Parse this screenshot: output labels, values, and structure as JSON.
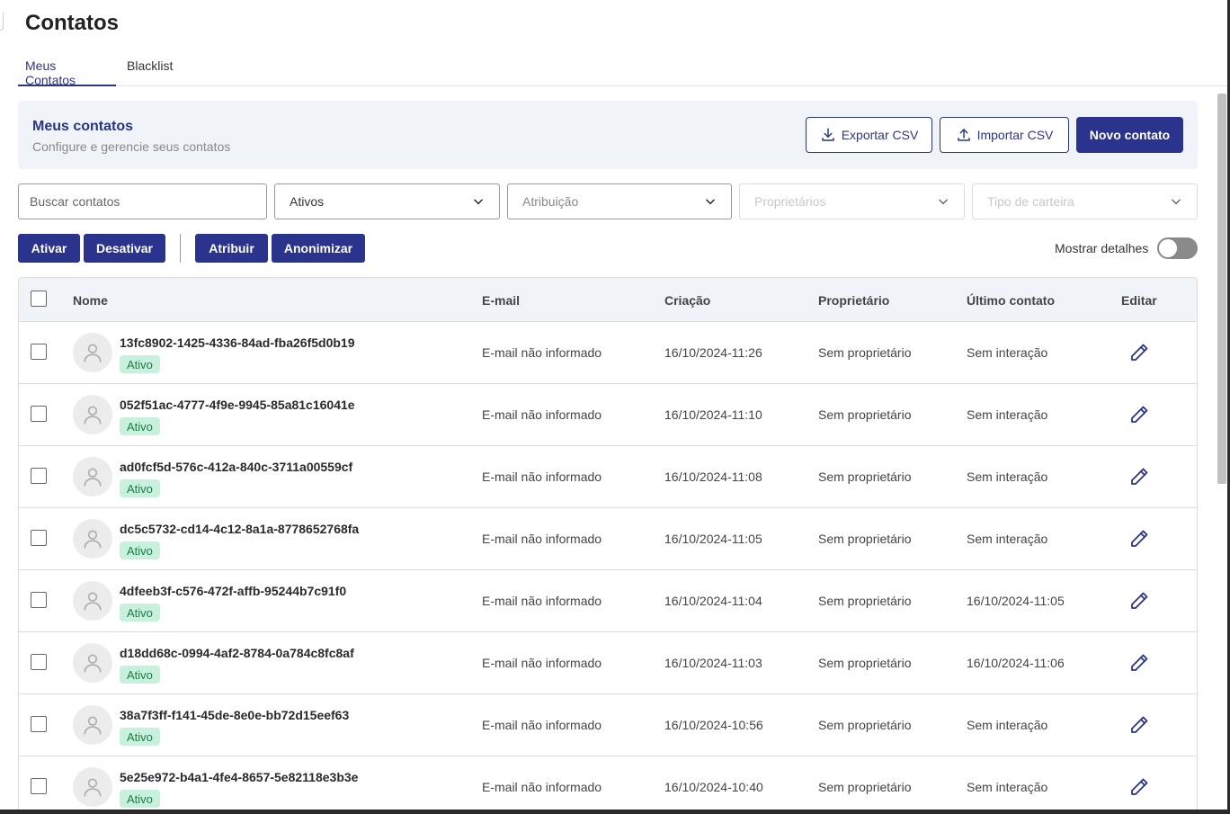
{
  "page": {
    "title": "Contatos"
  },
  "tabs": [
    {
      "label": "Meus Contatos"
    },
    {
      "label": "Blacklist"
    }
  ],
  "header": {
    "title": "Meus contatos",
    "subtitle": "Configure e gerencie seus contatos",
    "export_label": "Exportar CSV",
    "import_label": "Importar CSV",
    "new_label": "Novo contato"
  },
  "filters": {
    "search_placeholder": "Buscar contatos",
    "status": "Ativos",
    "attribution_placeholder": "Atribuição",
    "owners_placeholder": "Proprietários",
    "wallet_placeholder": "Tipo de carteira"
  },
  "actions": {
    "activate": "Ativar",
    "deactivate": "Desativar",
    "assign": "Atribuir",
    "anonymize": "Anonimizar",
    "show_details": "Mostrar detalhes",
    "show_details_on": false
  },
  "table": {
    "headers": {
      "name": "Nome",
      "email": "E-mail",
      "created": "Criação",
      "owner": "Proprietário",
      "last_contact": "Último contato",
      "edit": "Editar"
    },
    "rows": [
      {
        "name": "13fc8902-1425-4336-84ad-fba26f5d0b19",
        "status": "Ativo",
        "email": "E-mail não informado",
        "created": "16/10/2024-11:26",
        "owner": "Sem proprietário",
        "last_contact": "Sem interação"
      },
      {
        "name": "052f51ac-4777-4f9e-9945-85a81c16041e",
        "status": "Ativo",
        "email": "E-mail não informado",
        "created": "16/10/2024-11:10",
        "owner": "Sem proprietário",
        "last_contact": "Sem interação"
      },
      {
        "name": "ad0fcf5d-576c-412a-840c-3711a00559cf",
        "status": "Ativo",
        "email": "E-mail não informado",
        "created": "16/10/2024-11:08",
        "owner": "Sem proprietário",
        "last_contact": "Sem interação"
      },
      {
        "name": "dc5c5732-cd14-4c12-8a1a-8778652768fa",
        "status": "Ativo",
        "email": "E-mail não informado",
        "created": "16/10/2024-11:05",
        "owner": "Sem proprietário",
        "last_contact": "Sem interação"
      },
      {
        "name": "4dfeeb3f-c576-472f-affb-95244b7c91f0",
        "status": "Ativo",
        "email": "E-mail não informado",
        "created": "16/10/2024-11:04",
        "owner": "Sem proprietário",
        "last_contact": "16/10/2024-11:05"
      },
      {
        "name": "d18dd68c-0994-4af2-8784-0a784c8fc8af",
        "status": "Ativo",
        "email": "E-mail não informado",
        "created": "16/10/2024-11:03",
        "owner": "Sem proprietário",
        "last_contact": "16/10/2024-11:06"
      },
      {
        "name": "38a7f3ff-f141-45de-8e0e-bb72d15eef63",
        "status": "Ativo",
        "email": "E-mail não informado",
        "created": "16/10/2024-10:56",
        "owner": "Sem proprietário",
        "last_contact": "Sem interação"
      },
      {
        "name": "5e25e972-b4a1-4fe4-8657-5e82118e3b3e",
        "status": "Ativo",
        "email": "E-mail não informado",
        "created": "16/10/2024-10:40",
        "owner": "Sem proprietário",
        "last_contact": "Sem interação"
      }
    ]
  },
  "colors": {
    "primary": "#2a348c",
    "header_bg": "#f0f3f8",
    "badge_bg": "#c8f1dd",
    "badge_text": "#1e7a46"
  }
}
